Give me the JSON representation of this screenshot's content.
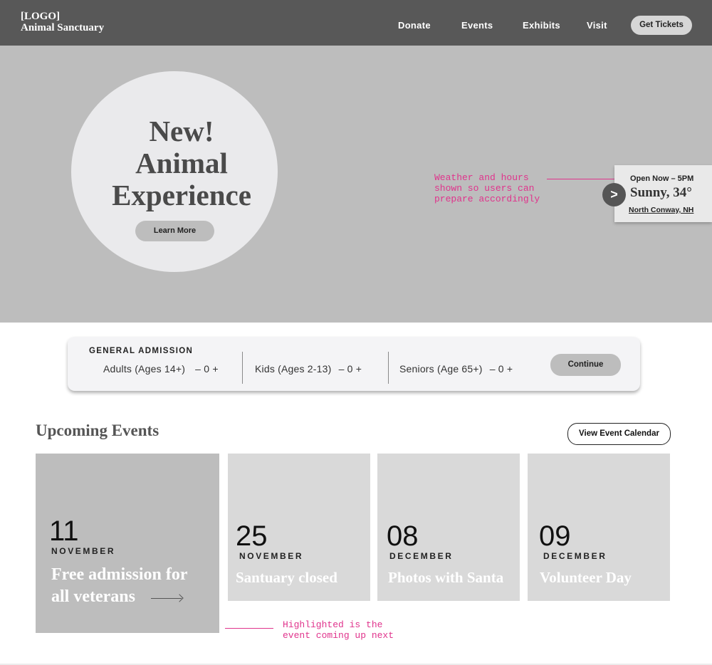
{
  "header": {
    "logo_line1": "[LOGO]",
    "logo_line2": "Animal Sanctuary",
    "nav": [
      "Donate",
      "Events",
      "Exhibits",
      "Visit"
    ],
    "tickets_label": "Get Tickets"
  },
  "hero": {
    "title_line1": "New!",
    "title_line2": "Animal",
    "title_line3": "Experience",
    "learn_more_label": "Learn More",
    "annotation": "Weather and hours\nshown so users can\nprepare accordingly",
    "weather": {
      "hours": "Open Now – 5PM",
      "temp": "Sunny, 34°",
      "location": "North Conway, NH",
      "arrow": ">"
    }
  },
  "admission": {
    "title": "GENERAL ADMISSION",
    "groups": [
      {
        "label": "Adults (Ages 14+)",
        "counter": "– 0 +"
      },
      {
        "label": "Kids (Ages 2-13)",
        "counter": "– 0 +"
      },
      {
        "label": "Seniors (Age 65+)",
        "counter": "– 0 +"
      }
    ],
    "continue_label": "Continue"
  },
  "events": {
    "title": "Upcoming Events",
    "calendar_label": "View Event Calendar",
    "items": [
      {
        "day": "11",
        "month": "NOVEMBER",
        "title_line1": "Free admission for",
        "title_line2": "all veterans"
      },
      {
        "day": "25",
        "month": "NOVEMBER",
        "title_line1": "Santuary closed"
      },
      {
        "day": "08",
        "month": "DECEMBER",
        "title_line1": "Photos with Santa"
      },
      {
        "day": "09",
        "month": "DECEMBER",
        "title_line1": "Volunteer Day"
      }
    ],
    "annotation": "Highlighted is the\nevent coming up next"
  },
  "colors": {
    "header_bg": "#585858",
    "hero_bg": "#bdbdbd",
    "annotation": "#e0338c",
    "card_bg": "#d9d9d9",
    "card_highlight": "#bdbdbd"
  }
}
